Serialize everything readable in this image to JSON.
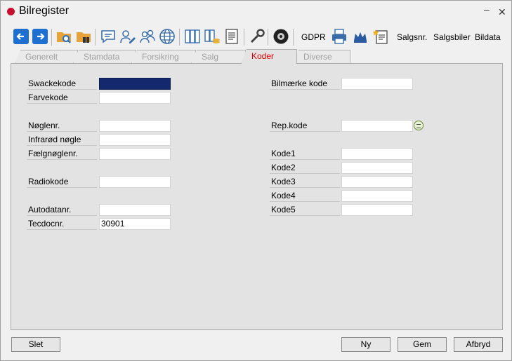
{
  "window": {
    "title": "Bilregister",
    "minimize": "–",
    "close": "✕"
  },
  "toolbar": {
    "gdpr": "GDPR",
    "salgsnr": "Salgsnr.",
    "salgsbiler": "Salgsbiler",
    "bildata": "Bildata"
  },
  "tabs": [
    {
      "label": "Generelt",
      "active": false
    },
    {
      "label": "Stamdata",
      "active": false
    },
    {
      "label": "Forsikring",
      "active": false
    },
    {
      "label": "Salg",
      "active": false
    },
    {
      "label": "Koder",
      "active": true
    },
    {
      "label": "Diverse",
      "active": false
    }
  ],
  "fields": {
    "swackekode": {
      "label": "Swackekode",
      "value": ""
    },
    "farvekode": {
      "label": "Farvekode",
      "value": ""
    },
    "noeglenr": {
      "label": "Nøglenr.",
      "value": ""
    },
    "infrarod": {
      "label": "Infrarød nøgle",
      "value": ""
    },
    "faelgnoeglenr": {
      "label": "Fælgnøglenr.",
      "value": ""
    },
    "radiokode": {
      "label": "Radiokode",
      "value": ""
    },
    "autodatanr": {
      "label": "Autodatanr.",
      "value": ""
    },
    "tecdocnr": {
      "label": "Tecdocnr.",
      "value": "30901"
    },
    "bilmaerke": {
      "label": "Bilmærke kode",
      "value": ""
    },
    "repkode": {
      "label": "Rep.kode",
      "value": ""
    },
    "kode1": {
      "label": "Kode1",
      "value": ""
    },
    "kode2": {
      "label": "Kode2",
      "value": ""
    },
    "kode3": {
      "label": "Kode3",
      "value": ""
    },
    "kode4": {
      "label": "Kode4",
      "value": ""
    },
    "kode5": {
      "label": "Kode5",
      "value": ""
    }
  },
  "buttons": {
    "slet": "Slet",
    "ny": "Ny",
    "gem": "Gem",
    "afbryd": "Afbryd"
  },
  "colors": {
    "accent_tab": "#e00000",
    "swacke_fill": "#14286e",
    "nav_blue": "#1e6fd0"
  },
  "icons": [
    "back-arrow-icon",
    "forward-arrow-icon",
    "folder-search-icon",
    "folder-binoculars-icon",
    "chat-icon",
    "user-edit-icon",
    "users-icon",
    "globe-icon",
    "binders-icon",
    "binder-coins-icon",
    "document-icon",
    "wrench-icon",
    "tire-icon",
    "printer-icon",
    "crown-icon",
    "new-document-icon"
  ]
}
